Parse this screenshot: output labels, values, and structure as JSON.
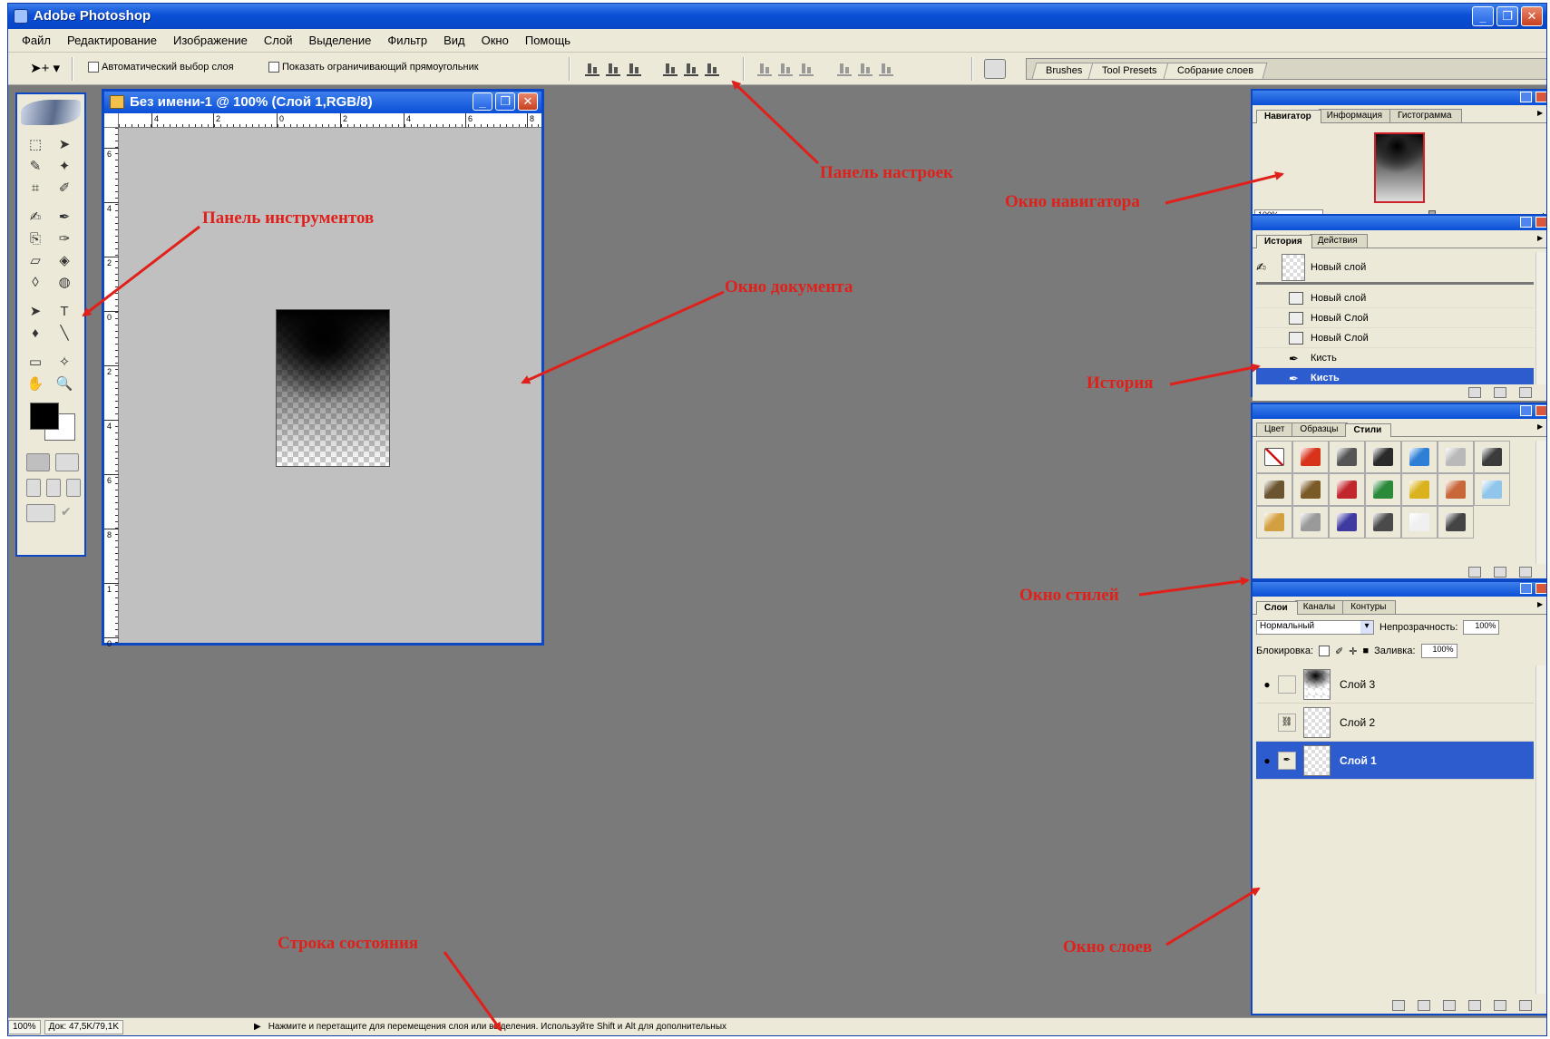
{
  "app": {
    "title": "Adobe Photoshop"
  },
  "window_buttons": {
    "minimize": "_",
    "restore": "❐",
    "close": "✕"
  },
  "menu": [
    "Файл",
    "Редактирование",
    "Изображение",
    "Слой",
    "Выделение",
    "Фильтр",
    "Вид",
    "Окно",
    "Помощь"
  ],
  "options_bar": {
    "tool_glyph": "➤+ ▾",
    "auto_select_label": "Автоматический выбор слоя",
    "show_bounds_label": "Показать ограничивающий прямоугольник",
    "palette_well_tabs": [
      "Brushes",
      "Tool Presets",
      "Собрание слоев"
    ]
  },
  "toolbox": {
    "tools": [
      "⬚",
      "➤",
      "✎",
      "✦",
      "⌗",
      "✐",
      "✍",
      "✒",
      "⎘",
      "✑",
      "▱",
      "◈",
      "◊",
      "◍",
      "➤",
      "T",
      "♦",
      "╲",
      "▭",
      "✧",
      "✋",
      "🔍"
    ]
  },
  "document": {
    "title": "Без имени-1 @ 100% (Слой 1,RGB/8)",
    "ruler_h_labels": [
      "4",
      "2",
      "0",
      "2",
      "4",
      "6",
      "8"
    ],
    "ruler_v_labels": [
      "6",
      "4",
      "2",
      "0",
      "2",
      "4",
      "6",
      "8",
      "1",
      "0"
    ]
  },
  "navigator": {
    "tabs": [
      "Навигатор",
      "Информация",
      "Гистограмма"
    ],
    "zoom": "100%",
    "zoom_level": 0.45
  },
  "history": {
    "tabs": [
      "История",
      "Действия"
    ],
    "snapshot_label": "Новый слой",
    "items": [
      {
        "label": "Новый слой",
        "icon": "layer-icon"
      },
      {
        "label": "Новый Слой",
        "icon": "layer-icon"
      },
      {
        "label": "Новый Слой",
        "icon": "layer-icon"
      },
      {
        "label": "Кисть",
        "icon": "brush-icon"
      },
      {
        "label": "Кисть",
        "icon": "brush-icon",
        "active": true
      }
    ]
  },
  "styles": {
    "tabs": [
      "Цвет",
      "Образцы",
      "Стили"
    ],
    "swatches": [
      "#ffffff",
      "#d8321a",
      "#555555",
      "#2a2a2a",
      "#2f7fd6",
      "#b9b9b9",
      "#3b3b3b",
      "#6b5530",
      "#7a5a26",
      "#c0262c",
      "#2a8a3a",
      "#d9b21e",
      "#c8673a",
      "#8fc6ea",
      "#d2a040",
      "#9a9a9a",
      "#3e3aa0",
      "#4a4a4a",
      "#f0f0f0",
      "#444444"
    ]
  },
  "layers": {
    "tabs": [
      "Слои",
      "Каналы",
      "Контуры"
    ],
    "blend_mode": "Нормальный",
    "opacity_label": "Непрозрачность:",
    "opacity_value": "100%",
    "lock_label": "Блокировка:",
    "fill_label": "Заливка:",
    "fill_value": "100%",
    "items": [
      {
        "name": "Слой 3",
        "visible": true
      },
      {
        "name": "Слой 2",
        "visible": false
      },
      {
        "name": "Слой 1",
        "visible": true,
        "active": true
      }
    ]
  },
  "status_bar": {
    "zoom": "100%",
    "doc_size": "Док: 47,5K/79,1K",
    "hint": "Нажмите и перетащите для перемещения слоя или выделения. Используйте Shift и Alt для дополнительных"
  },
  "annotations": {
    "options_panel": "Панель настроек",
    "tools_panel": "Панель инструментов",
    "navigator_window": "Окно навигатора",
    "document_window": "Окно документа",
    "history": "История",
    "styles_window": "Окно стилей",
    "status_line": "Строка состояния",
    "layers_window": "Окно слоев"
  },
  "colors": {
    "title_blue": "#0a4fd6",
    "annotation_red": "#e0201b",
    "workspace_gray": "#7a7a7a",
    "panel_bg": "#ece9d8"
  }
}
